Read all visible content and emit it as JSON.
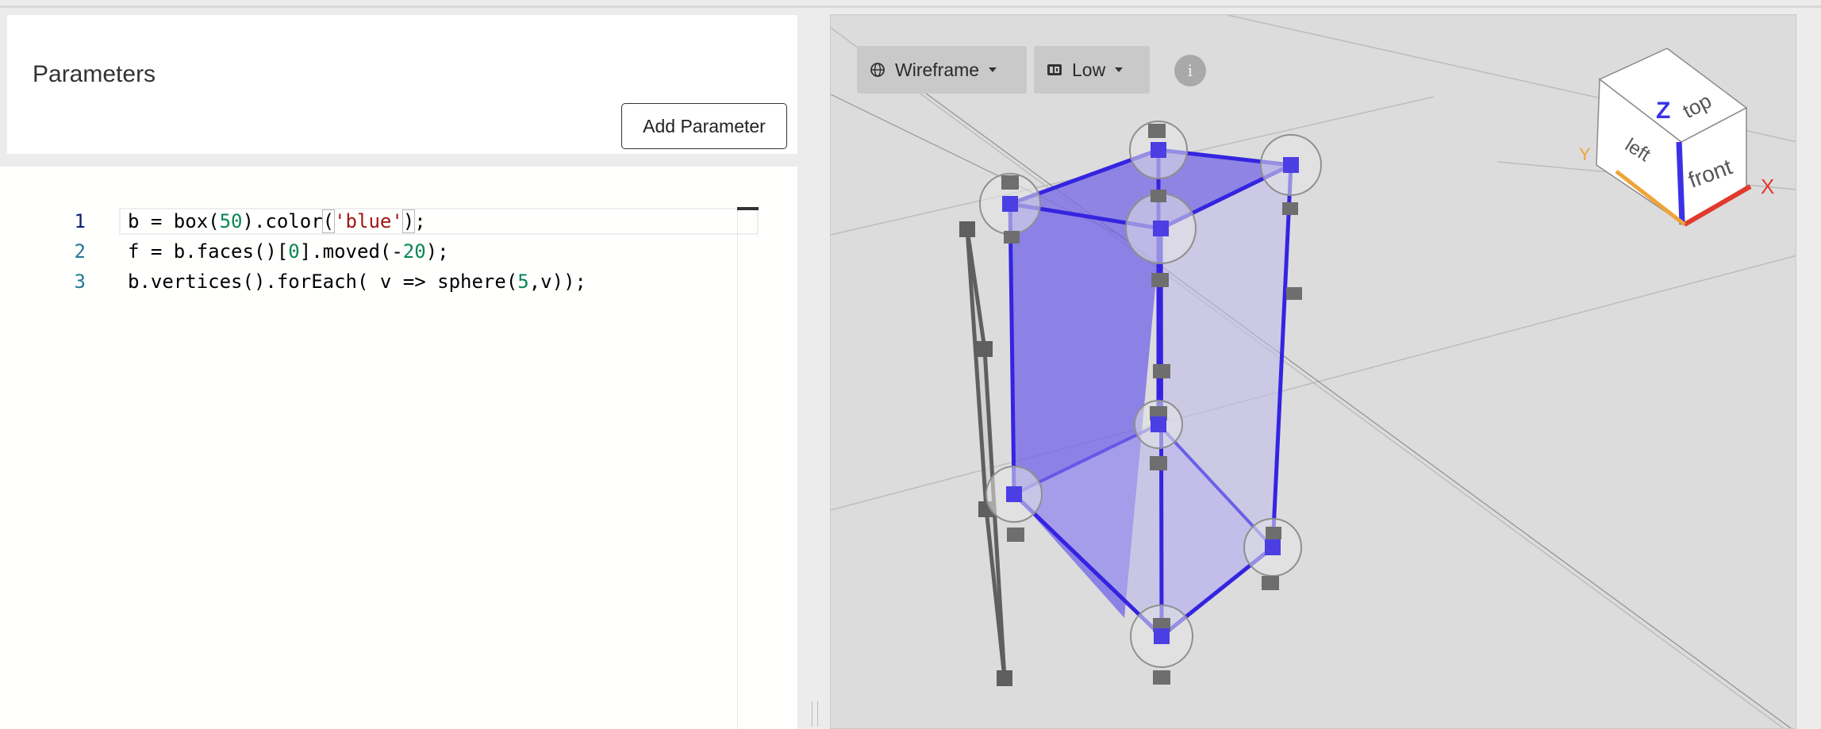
{
  "parameters": {
    "title": "Parameters",
    "add_button": "Add Parameter"
  },
  "editor": {
    "lines": [
      {
        "no": "1"
      },
      {
        "no": "2"
      },
      {
        "no": "3"
      }
    ],
    "line1": {
      "a": "b = box(",
      "n1": "50",
      "b": ").color",
      "open": "(",
      "s": "'blue'",
      "close": ")",
      "c": ";"
    },
    "line2": {
      "a": "f = b.faces()[",
      "n1": "0",
      "b": "].moved(-",
      "n2": "20",
      "c": ");"
    },
    "line3": {
      "a": "b.vertices().forEach( v => sphere(",
      "n1": "5",
      "b": ",v));"
    }
  },
  "viewport": {
    "render_mode": "Wireframe",
    "quality": "Low",
    "info": "i",
    "view_cube": {
      "top": "top",
      "front": "front",
      "left": "left",
      "axis_x": "X",
      "axis_y": "Y",
      "axis_z": "Z"
    },
    "colors": {
      "box": "#4a3de0",
      "face": "#7b7b7b",
      "x_axis": "#e03a2c",
      "y_axis": "#eda53a",
      "z_axis": "#3b31e6"
    }
  }
}
